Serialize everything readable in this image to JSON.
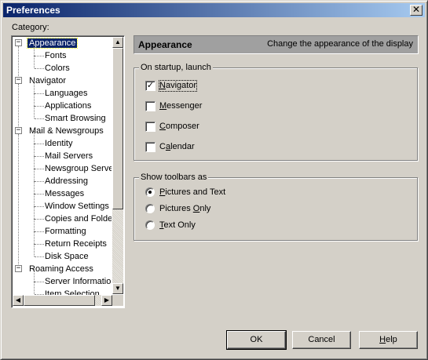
{
  "window": {
    "title": "Preferences",
    "close_glyph": "✕"
  },
  "category_label": "Category:",
  "tree": {
    "items": [
      {
        "label": "Appearance",
        "level": 0,
        "expander": "−",
        "selected": true
      },
      {
        "label": "Fonts",
        "level": 1
      },
      {
        "label": "Colors",
        "level": 1
      },
      {
        "label": "Navigator",
        "level": 0,
        "expander": "−"
      },
      {
        "label": "Languages",
        "level": 1
      },
      {
        "label": "Applications",
        "level": 1
      },
      {
        "label": "Smart Browsing",
        "level": 1
      },
      {
        "label": "Mail & Newsgroups",
        "level": 0,
        "expander": "−"
      },
      {
        "label": "Identity",
        "level": 1
      },
      {
        "label": "Mail Servers",
        "level": 1
      },
      {
        "label": "Newsgroup Servers",
        "level": 1
      },
      {
        "label": "Addressing",
        "level": 1
      },
      {
        "label": "Messages",
        "level": 1
      },
      {
        "label": "Window Settings",
        "level": 1
      },
      {
        "label": "Copies and Folders",
        "level": 1
      },
      {
        "label": "Formatting",
        "level": 1
      },
      {
        "label": "Return Receipts",
        "level": 1
      },
      {
        "label": "Disk Space",
        "level": 1
      },
      {
        "label": "Roaming Access",
        "level": 0,
        "expander": "−"
      },
      {
        "label": "Server Information",
        "level": 1
      },
      {
        "label": "Item Selection",
        "level": 1
      }
    ],
    "scroll_up": "▲",
    "scroll_down": "▼",
    "scroll_left": "◀",
    "scroll_right": "▶"
  },
  "header": {
    "title": "Appearance",
    "description": "Change the appearance of the display"
  },
  "startup": {
    "legend": "On startup, launch",
    "options": [
      {
        "label": "Navigator",
        "checked": true
      },
      {
        "label": "Messenger",
        "checked": false
      },
      {
        "label": "Composer",
        "checked": false
      },
      {
        "label": "Calendar",
        "checked": false
      }
    ],
    "check_glyph": "✓"
  },
  "toolbars": {
    "legend": "Show toolbars as",
    "options": [
      {
        "label": "Pictures and Text",
        "selected": true
      },
      {
        "label": "Pictures Only",
        "selected": false
      },
      {
        "label": "Text Only",
        "selected": false
      }
    ]
  },
  "buttons": {
    "ok": "OK",
    "cancel": "Cancel",
    "help": "Help"
  }
}
